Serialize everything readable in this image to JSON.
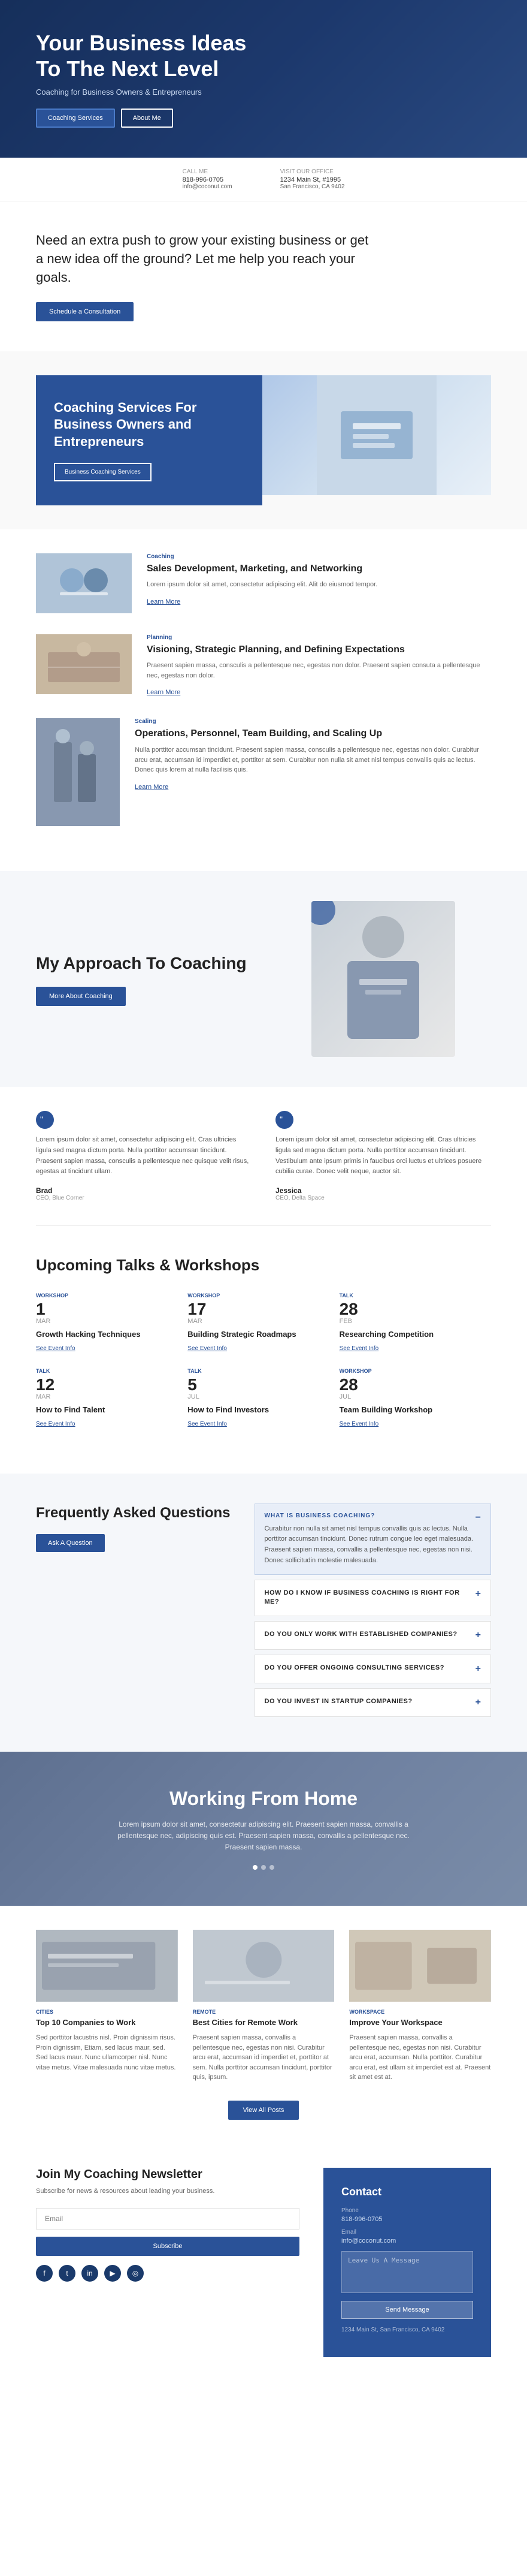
{
  "hero": {
    "title": "Your Business Ideas To The Next Level",
    "subtitle": "Coaching for Business Owners & Entrepreneurs",
    "btn_coaching": "Coaching Services",
    "btn_about": "About Me"
  },
  "contact_bar": {
    "call_label": "Call Me",
    "call_phone": "818-996-0705",
    "call_email": "info@coconut.com",
    "visit_label": "Visit Our Office",
    "visit_address": "1234 Main St, #1995",
    "visit_city": "San Francisco, CA 9402"
  },
  "push": {
    "text": "Need an extra push to grow your existing business or get a new idea off the ground? Let me help you reach your goals.",
    "btn_schedule": "Schedule a Consultation"
  },
  "coaching_services": {
    "title": "Coaching Services For Business Owners and Entrepreneurs",
    "btn_label": "Business Coaching Services"
  },
  "services": [
    {
      "tag": "Coaching",
      "title": "Sales Development, Marketing, and Networking",
      "desc": "Lorem ipsum dolor sit amet, consectetur adipiscing elit. Alit do eiusmod tempor.",
      "learn_more": "Learn More"
    },
    {
      "tag": "Planning",
      "title": "Visioning, Strategic Planning, and Defining Expectations",
      "desc": "Praesent sapien massa, consculis a pellentesque nec, egestas non dolor. Praesent sapien consuta a pellentesque nec, egestas non dolor.",
      "learn_more": "Learn More"
    },
    {
      "tag": "Scaling",
      "title": "Operations, Personnel, Team Building, and Scaling Up",
      "desc": "Nulla porttitor accumsan tincidunt. Praesent sapien massa, consculis a pellentesque nec, egestas non dolor. Curabitur arcu erat, accumsan id imperdiet et, porttitor at sem. Curabitur non nulla sit amet nisl tempus convallis quis ac lectus. Donec quis lorem at nulla facilisis quis.",
      "learn_more": "Learn More"
    }
  ],
  "approach": {
    "title": "My Approach To Coaching",
    "btn_label": "More About Coaching"
  },
  "testimonials": [
    {
      "text": "Lorem ipsum dolor sit amet, consectetur adipiscing elit. Cras ultricies ligula sed magna dictum porta. Nulla porttitor accumsan tincidunt. Praesent sapien massa, consculis a pellentesque nec quisque velit risus, egestas at tincidunt ullam.",
      "author": "Brad",
      "role": "CEO, Blue Corner"
    },
    {
      "text": "Lorem ipsum dolor sit amet, consectetur adipiscing elit. Cras ultricies ligula sed magna dictum porta. Nulla porttitor accumsan tincidunt. Vestibulum ante ipsum primis in faucibus orci luctus et ultrices posuere cubilia curae. Donec velit neque, auctor sit.",
      "author": "Jessica",
      "role": "CEO, Delta Space"
    }
  ],
  "talks": {
    "title": "Upcoming Talks & Workshops",
    "items": [
      {
        "day": "1",
        "month": "Mar",
        "type": "Workshop",
        "name": "Growth Hacking Techniques",
        "link": "See Event Info"
      },
      {
        "day": "17",
        "month": "Mar",
        "type": "Workshop",
        "name": "Building Strategic Roadmaps",
        "link": "See Event Info"
      },
      {
        "day": "28",
        "month": "Feb",
        "type": "Talk",
        "name": "Researching Competition",
        "link": "See Event Info"
      },
      {
        "day": "12",
        "month": "Mar",
        "type": "Talk",
        "name": "How to Find Talent",
        "link": "See Event Info"
      },
      {
        "day": "5",
        "month": "Jul",
        "type": "Talk",
        "name": "How to Find Investors",
        "link": "See Event Info"
      },
      {
        "day": "28",
        "month": "Jul",
        "type": "Workshop",
        "name": "Team Building Workshop",
        "link": "See Event Info"
      }
    ]
  },
  "faq": {
    "title": "Frequently Asked Questions",
    "btn_label": "Ask A Question",
    "items": [
      {
        "question": "WHAT IS BUSINESS COACHING?",
        "answer": "Curabitur non nulla sit amet nisl tempus convallis quis ac lectus. Nulla porttitor accumsan tincidunt. Donec rutrum congue leo eget malesuada. Praesent sapien massa, convallis a pellentesque nec, egestas non nisi. Donec sollicitudin molestie malesuada.",
        "open": true
      },
      {
        "question": "HOW DO I KNOW IF BUSINESS COACHING IS RIGHT FOR ME?",
        "answer": "",
        "open": false
      },
      {
        "question": "DO YOU ONLY WORK WITH ESTABLISHED COMPANIES?",
        "answer": "",
        "open": false
      },
      {
        "question": "DO YOU OFFER ONGOING CONSULTING SERVICES?",
        "answer": "",
        "open": false
      },
      {
        "question": "DO YOU INVEST IN STARTUP COMPANIES?",
        "answer": "",
        "open": false
      }
    ]
  },
  "wfh": {
    "title": "Working From Home",
    "text": "Lorem ipsum dolor sit amet, consectetur adipiscing elit. Praesent sapien massa, convallis a pellentesque nec, adipiscing quis est. Praesent sapien massa, convallis a pellentesque nec. Praesent sapien massa."
  },
  "blog": {
    "posts": [
      {
        "tag": "Cities",
        "title": "Top 10 Companies to Work",
        "text": "Sed porttitor lacustris nisl. Proin dignissim risus. Proin dignissim, Etiam, sed lacus maur, sed. Sed lacus maur. Nunc ullamcorper nisl. Nunc vitae metus. Vitae malesuada nunc vitae metus."
      },
      {
        "tag": "Remote",
        "title": "Best Cities for Remote Work",
        "text": "Praesent sapien massa, convallis a pellentesque nec, egestas non nisi. Curabitur arcu erat, accumsan id imperdiet et, porttitor at sem. Nulla porttitor accumsan tincidunt, porttitor quis, ipsum."
      },
      {
        "tag": "Workspace",
        "title": "Improve Your Workspace",
        "text": "Praesent sapien massa, convallis a pellentesque nec, egestas non nisi. Curabitur arcu erat, accumsan. Nulla porttitor. Curabitur arcu erat, est ullam sit imperdiet est at. Praesent sit amet est at."
      }
    ],
    "btn_label": "View All Posts"
  },
  "newsletter": {
    "title": "Join My Coaching Newsletter",
    "text": "Subscribe for news & resources about leading your business.",
    "input_placeholder": "Email",
    "btn_label": "Subscribe"
  },
  "contact": {
    "title": "Contact",
    "phone": "818-996-0705",
    "email": "info@coconut.com",
    "form_placeholder": "Leave Us A Message",
    "btn_send": "Send Message",
    "address": "1234 Main St, San Francisco, CA 9402"
  },
  "social": {
    "icons": [
      "f",
      "t",
      "in",
      "yt",
      "ig"
    ]
  }
}
